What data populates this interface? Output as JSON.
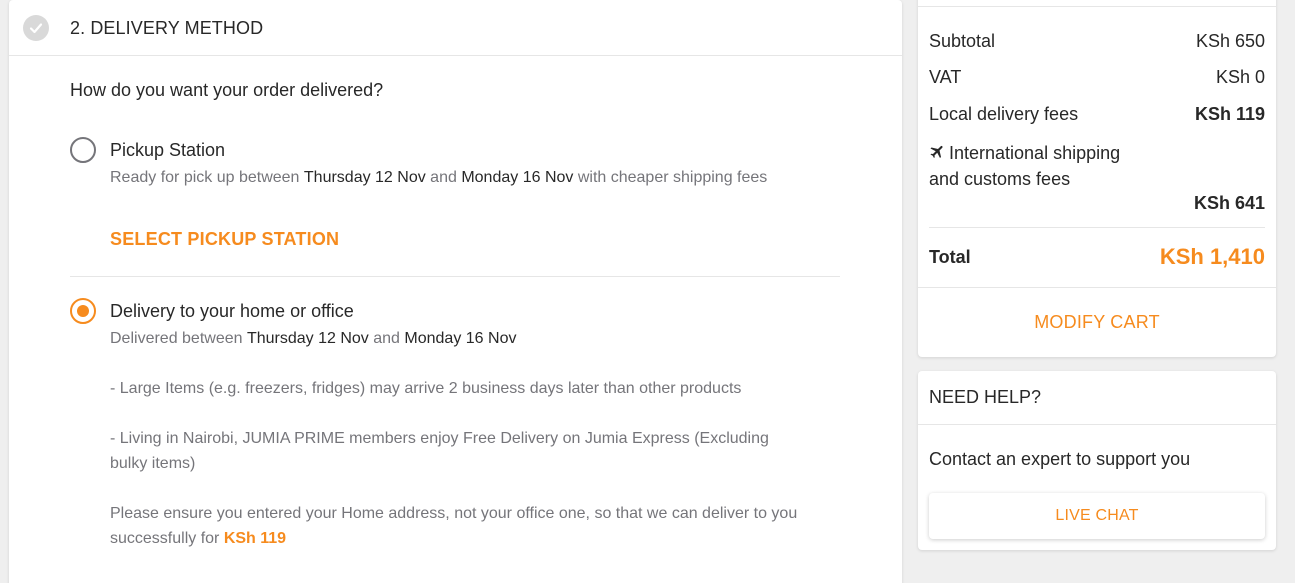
{
  "delivery": {
    "title": "2. DELIVERY METHOD",
    "question": "How do you want your order delivered?",
    "pickup": {
      "title": "Pickup Station",
      "desc_prefix": "Ready for pick up between ",
      "date_from": "Thursday 12 Nov",
      "desc_and": " and ",
      "date_to": "Monday 16 Nov",
      "desc_suffix": " with cheaper shipping fees",
      "select_label": "SELECT PICKUP STATION"
    },
    "home": {
      "title": "Delivery to your home or office",
      "desc_prefix": "Delivered between ",
      "date_from": "Thursday 12 Nov",
      "desc_and": " and ",
      "date_to": "Monday 16 Nov",
      "note_large": "- Large Items (e.g. freezers, fridges) may arrive 2 business days later than other products",
      "note_nairobi": "- Living in Nairobi, JUMIA PRIME members enjoy Free Delivery on Jumia Express (Excluding bulky items)",
      "note_address": "Please ensure you entered your Home address, not your office one, so that we can deliver to you successfully for ",
      "note_fee": "KSh 119"
    },
    "selected_option": "home"
  },
  "summary": {
    "subtotal_label": "Subtotal",
    "subtotal_value": "KSh 650",
    "vat_label": "VAT",
    "vat_value": "KSh 0",
    "local_fee_label": "Local delivery fees",
    "local_fee_value": "KSh 119",
    "intl_label": "International shipping and customs fees",
    "intl_value": "KSh 641",
    "total_label": "Total",
    "total_value": "KSh 1,410",
    "modify_label": "MODIFY CART"
  },
  "help": {
    "title": "NEED HELP?",
    "text": "Contact an expert to support you",
    "chat_label": "LIVE CHAT"
  },
  "colors": {
    "accent": "#f68b1e",
    "text": "#282828",
    "muted": "#75757a",
    "background": "#efefef"
  },
  "icons": {
    "step_done": "check-circle-icon",
    "intl": "airplane-icon"
  }
}
